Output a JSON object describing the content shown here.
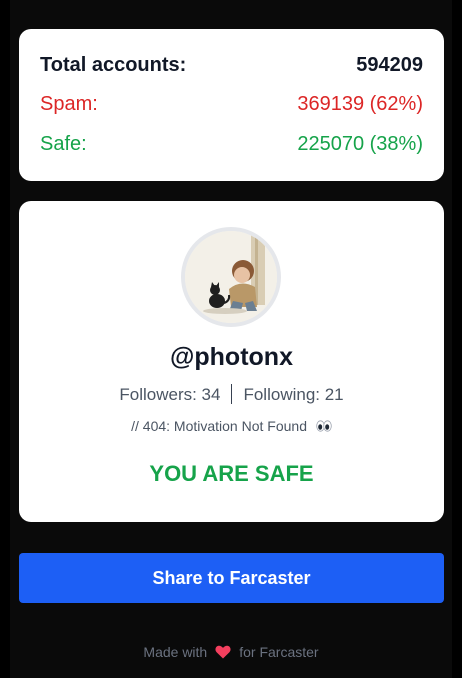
{
  "stats": {
    "total_label": "Total accounts:",
    "total_value": "594209",
    "spam_label": "Spam:",
    "spam_value": "369139 (62%)",
    "safe_label": "Safe:",
    "safe_value": "225070 (38%)"
  },
  "profile": {
    "username": "@photonx",
    "followers_text": "Followers: 34",
    "following_text": "Following: 21",
    "bio": "// 404: Motivation Not Found",
    "verdict": "YOU ARE SAFE"
  },
  "share_button_label": "Share to Farcaster",
  "footer": {
    "prefix": "Made with",
    "suffix": "for Farcaster"
  },
  "colors": {
    "spam": "#dc2626",
    "safe": "#16a34a",
    "button": "#1d5ff5",
    "background": "#000000"
  },
  "icons": {
    "bio_icon": "eyes-icon",
    "footer_icon": "heart-icon"
  }
}
